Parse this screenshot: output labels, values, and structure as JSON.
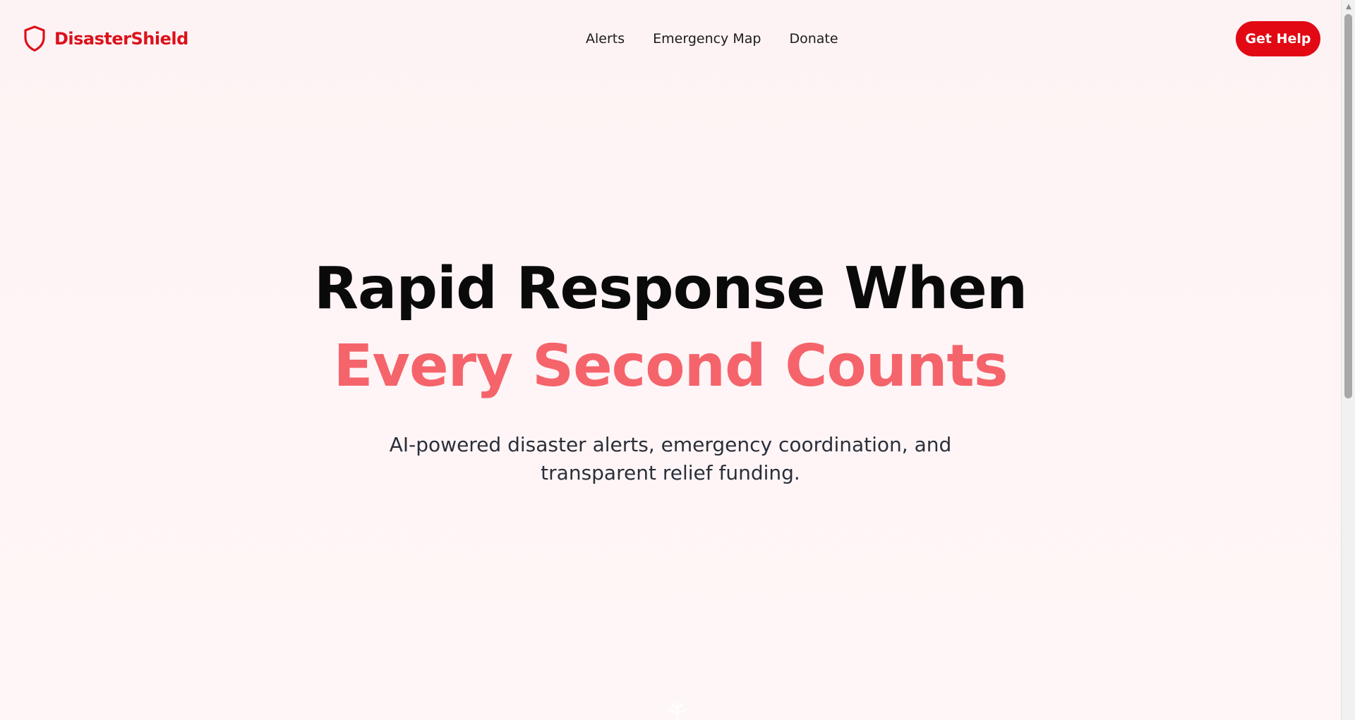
{
  "brand": {
    "name": "DisasterShield",
    "logo_icon": "shield-icon",
    "color": "#dc111b"
  },
  "nav": {
    "items": [
      {
        "label": "Alerts"
      },
      {
        "label": "Emergency Map"
      },
      {
        "label": "Donate"
      }
    ]
  },
  "cta": {
    "label": "Get Help",
    "color": "#e20914"
  },
  "hero": {
    "title_line1": "Rapid Response When",
    "title_line2": "Every Second Counts",
    "accent_color": "#f5646b",
    "subtitle": "AI-powered disaster alerts, emergency coordination, and transparent relief funding."
  },
  "scrollbar": {
    "up_arrow_icon": "triangle-up-icon"
  }
}
